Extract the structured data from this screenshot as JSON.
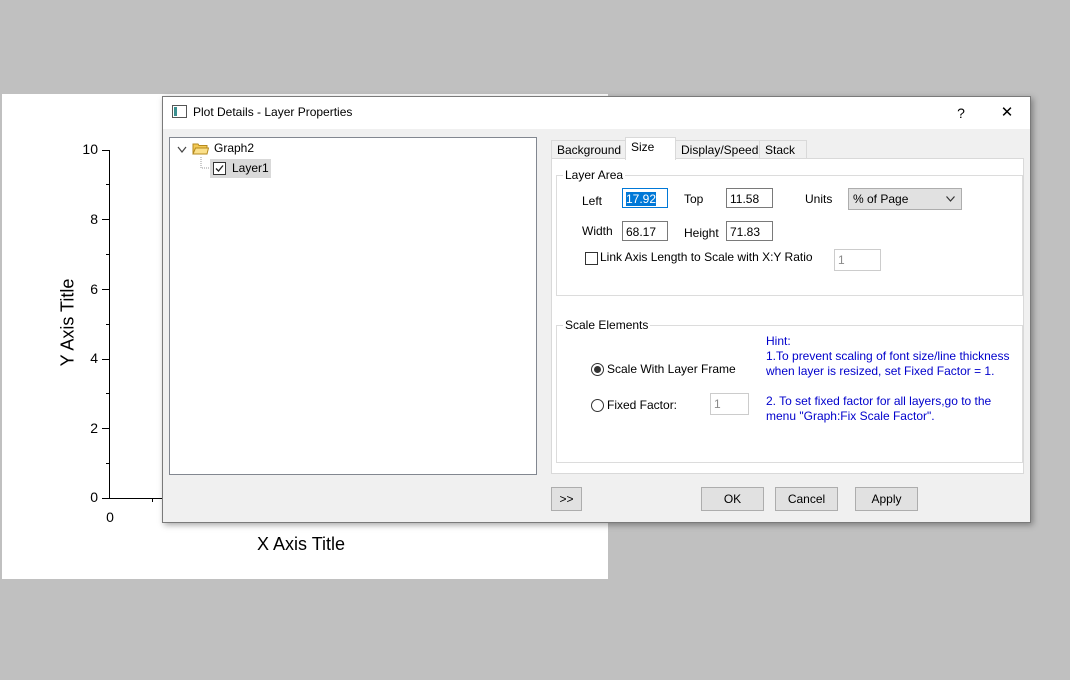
{
  "graph": {
    "y_ticks": [
      "10",
      "8",
      "6",
      "4",
      "2",
      "0"
    ],
    "x_tick": "0",
    "y_axis_title": "Y Axis Title",
    "x_axis_title": "X Axis Title"
  },
  "dialog": {
    "title": "Plot Details - Layer Properties",
    "help_label": "?",
    "close_label": "✕",
    "tree": {
      "root": "Graph2",
      "child": "Layer1",
      "child_checked": true
    },
    "tabs": [
      "Background",
      "Size",
      "Display/Speed",
      "Stack"
    ],
    "active_tab": "Size",
    "layer_area": {
      "title": "Layer Area",
      "left_label": "Left",
      "left_value": "17.92",
      "top_label": "Top",
      "top_value": "11.58",
      "units_label": "Units",
      "units_value": "% of Page",
      "width_label": "Width",
      "width_value": "68.17",
      "height_label": "Height",
      "height_value": "71.83",
      "link_label": "Link Axis Length to Scale with X:Y Ratio",
      "link_checked": false,
      "ratio_value": "1"
    },
    "scale_elements": {
      "title": "Scale Elements",
      "scale_with_frame_label": "Scale With Layer Frame",
      "fixed_factor_label": "Fixed Factor:",
      "fixed_factor_value": "1",
      "selected": "scale_with_frame",
      "hint_title": "Hint:",
      "hint_1a": "1.To prevent scaling of font size/line thickness",
      "hint_1b": "when layer is resized, set Fixed Factor = 1.",
      "hint_2a": "2. To set fixed factor for all layers,go to the",
      "hint_2b": "menu \"Graph:Fix Scale Factor\"."
    },
    "buttons": {
      "expand": ">>",
      "ok": "OK",
      "cancel": "Cancel",
      "apply": "Apply"
    }
  }
}
